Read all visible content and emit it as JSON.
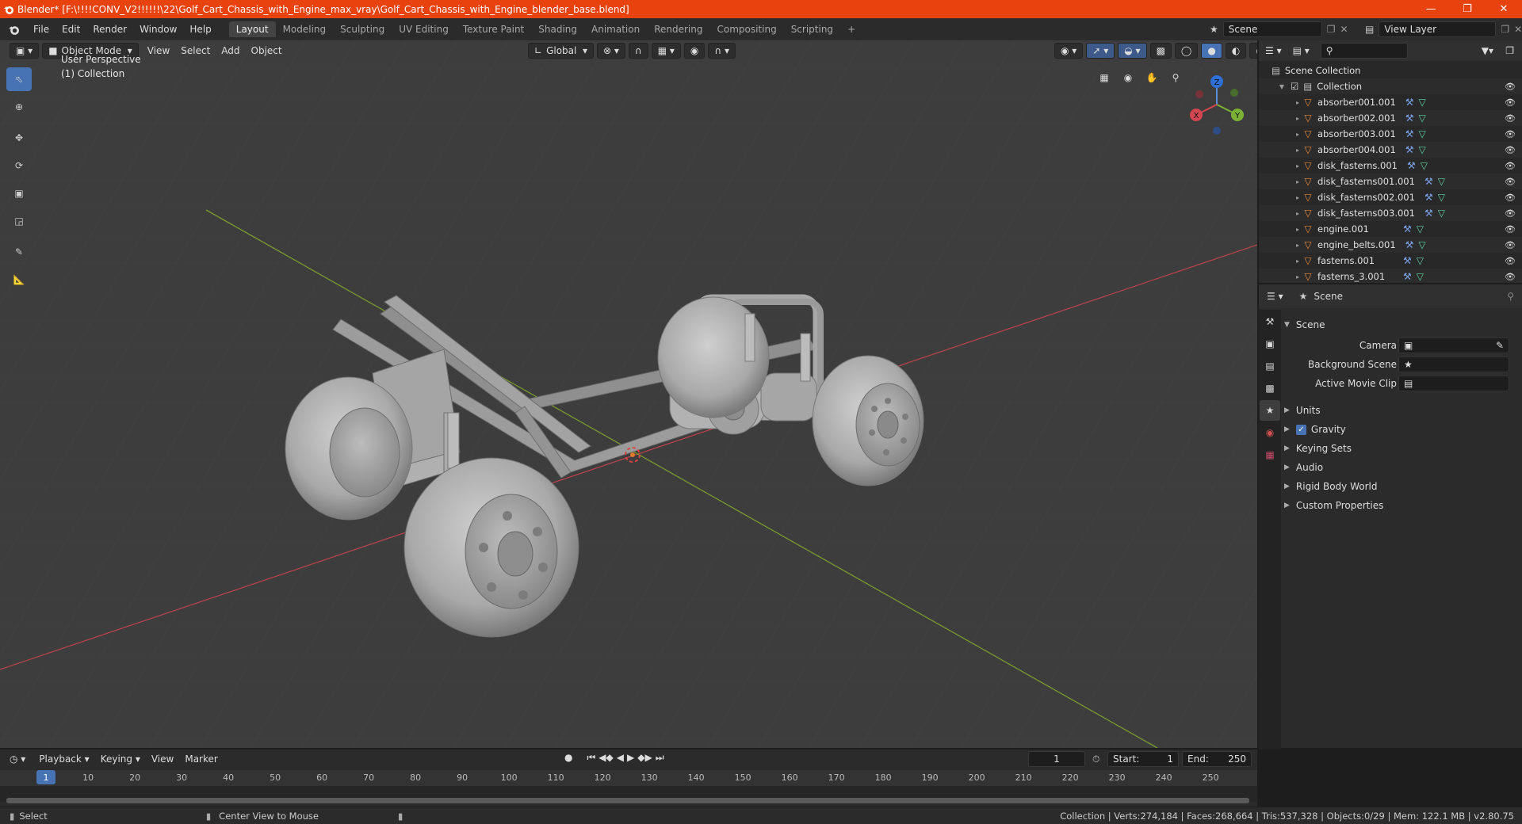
{
  "window": {
    "title": "Blender* [F:\\!!!!CONV_V2!!!!!!\\22\\Golf_Cart_Chassis_with_Engine_max_vray\\Golf_Cart_Chassis_with_Engine_blender_base.blend]"
  },
  "menu": [
    "File",
    "Edit",
    "Render",
    "Window",
    "Help"
  ],
  "workspaces": [
    "Layout",
    "Modeling",
    "Sculpting",
    "UV Editing",
    "Texture Paint",
    "Shading",
    "Animation",
    "Rendering",
    "Compositing",
    "Scripting"
  ],
  "active_workspace": "Layout",
  "scene_name": "Scene",
  "view_layer": "View Layer",
  "viewport": {
    "mode": "Object Mode",
    "menus": [
      "View",
      "Select",
      "Add",
      "Object"
    ],
    "transform_orientation": "Global",
    "perspective_label": "User Perspective",
    "collection_label": "(1) Collection",
    "gizmo": {
      "x": "X",
      "y": "Y",
      "z": "Z"
    }
  },
  "outliner": {
    "root": "Scene Collection",
    "collection": "Collection",
    "items": [
      "absorber001.001",
      "absorber002.001",
      "absorber003.001",
      "absorber004.001",
      "disk_fasterns.001",
      "disk_fasterns001.001",
      "disk_fasterns002.001",
      "disk_fasterns003.001",
      "engine.001",
      "engine_belts.001",
      "fasterns.001",
      "fasterns_3.001"
    ]
  },
  "properties": {
    "context": "Scene",
    "panel_title": "Scene",
    "fields": {
      "camera_label": "Camera",
      "background_scene_label": "Background Scene",
      "active_movie_clip_label": "Active Movie Clip"
    },
    "sections": [
      "Units",
      "Gravity",
      "Keying Sets",
      "Audio",
      "Rigid Body World",
      "Custom Properties"
    ],
    "gravity_checked": true
  },
  "timeline": {
    "menus": [
      "Playback",
      "Keying",
      "View",
      "Marker"
    ],
    "current_frame": "1",
    "start_label": "Start:",
    "start": "1",
    "end_label": "End:",
    "end": "250",
    "ruler": [
      "1",
      "10",
      "20",
      "30",
      "40",
      "50",
      "60",
      "70",
      "80",
      "90",
      "100",
      "110",
      "120",
      "130",
      "140",
      "150",
      "160",
      "170",
      "180",
      "190",
      "200",
      "210",
      "220",
      "230",
      "240",
      "250"
    ]
  },
  "statusbar": {
    "left_action": "Select",
    "middle_action": "Center View to Mouse",
    "stats": "Collection | Verts:274,184 | Faces:268,664 | Tris:537,328 | Objects:0/29 | Mem: 122.1 MB | v2.80.75"
  },
  "colors": {
    "titlebar": "#e8430f",
    "accent": "#4772b3",
    "viewport_bg": "#3d3d3d",
    "axis_x": "#b5434d",
    "axis_y": "#7a9a2e"
  }
}
